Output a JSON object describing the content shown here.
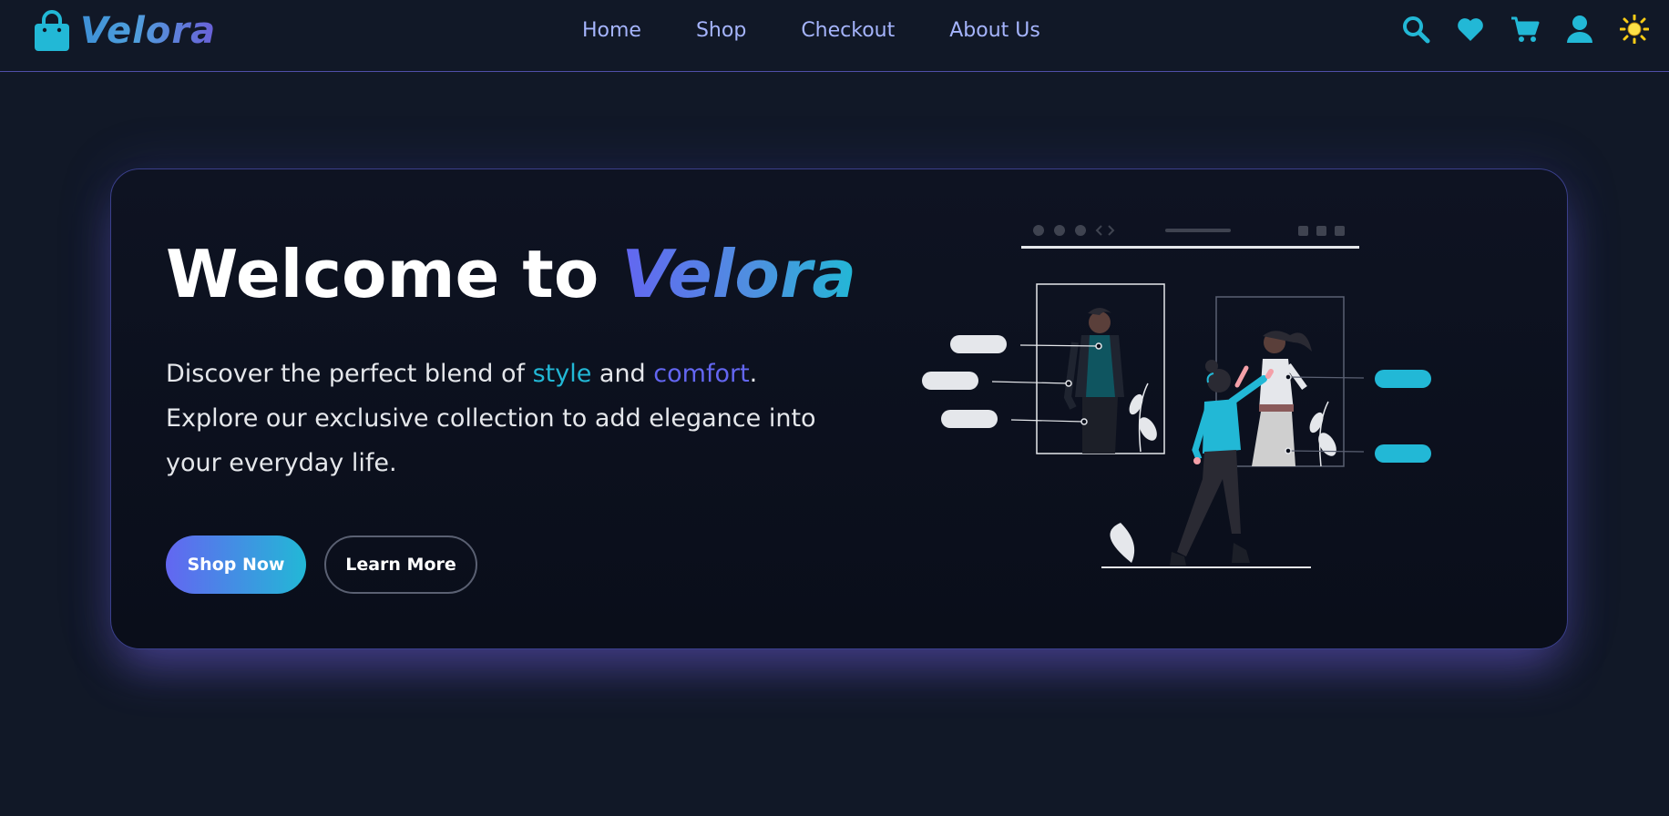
{
  "brand": {
    "name": "Velora",
    "logo_icon": "shopping-bag-icon"
  },
  "nav": {
    "links": [
      "Home",
      "Shop",
      "Checkout",
      "About Us"
    ],
    "icons": [
      "search-icon",
      "heart-icon",
      "cart-icon",
      "user-icon",
      "sun-icon"
    ]
  },
  "hero": {
    "title_prefix": "Welcome to ",
    "title_brand": "Velora",
    "desc_part1": "Discover the perfect blend of ",
    "desc_style": "style",
    "desc_and": " and ",
    "desc_comfort": "comfort",
    "desc_part2": ". Explore our exclusive collection to add elegance into your everyday life.",
    "primary_button": "Shop Now",
    "secondary_button": "Learn More"
  },
  "colors": {
    "background": "#111827",
    "accent_cyan": "#22b8d6",
    "accent_indigo": "#6366f1",
    "nav_link": "#a5b4fc"
  }
}
